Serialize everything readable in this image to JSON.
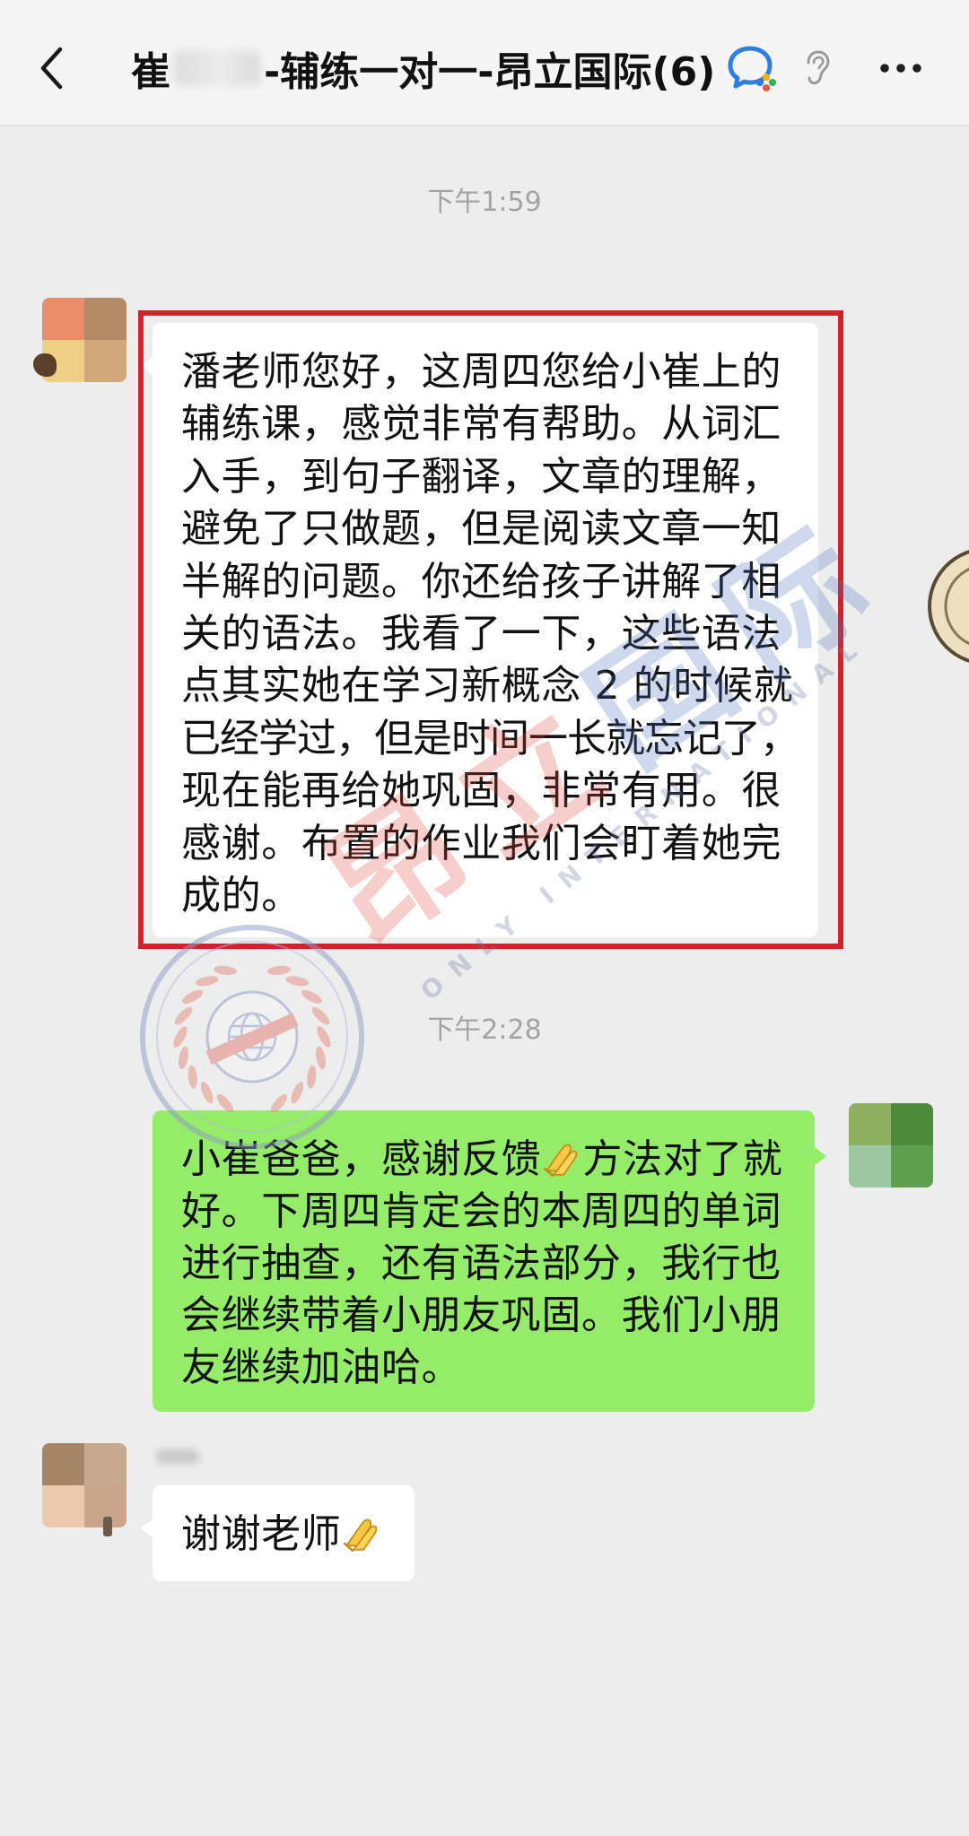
{
  "header": {
    "title_prefix": "崔",
    "title_suffix": "-辅练一对一-昂立国际(6)",
    "icons": {
      "back": "chevron-left-icon",
      "group_type": "wecom-chat-icon",
      "earpiece": "ear-icon",
      "more": "more-dots-icon"
    }
  },
  "chat": {
    "timestamps": [
      "下午1:59",
      "下午2:28"
    ],
    "messages": [
      {
        "direction": "incoming",
        "highlighted": true,
        "lines": [
          "潘老师您好，这周四您给小崔上的",
          "辅练课，感觉非常有帮助。从词汇",
          "入手，到句子翻译，文章的理解，",
          "避免了只做题，但是阅读文章一知",
          "半解的问题。你还给孩子讲解了相",
          "关的语法。我看了一下，这些语法",
          "点其实她在学习新概念 2 的时候就",
          "已经学过，但是时间一长就忘记了，",
          "现在能再给她巩固，非常有用。很",
          "感谢。布置的作业我们会盯着她完",
          "成的。"
        ]
      },
      {
        "direction": "outgoing",
        "highlighted": false,
        "lines": [
          "小崔爸爸，感谢反馈🙏方法对了就",
          "好。下周四肯定会的本周四的单词",
          "进行抽查，还有语法部分，我行也",
          "会继续带着小朋友巩固。我们小朋",
          "友继续加油哈。"
        ]
      },
      {
        "direction": "incoming",
        "highlighted": false,
        "lines": [
          "谢谢老师🙏"
        ]
      }
    ]
  },
  "watermark": {
    "text_cn": "昂立国际",
    "text_en": "ONLY INTERNATIONAL"
  },
  "colors": {
    "chat_background": "#ededed",
    "header_background": "#f5f5f5",
    "incoming_bubble": "#ffffff",
    "outgoing_bubble": "#95ec69",
    "highlight_border": "#d4222a",
    "timestamp_text": "#a3a3a3",
    "watermark_red": "#e0453e",
    "watermark_blue": "#4a6fc0"
  }
}
